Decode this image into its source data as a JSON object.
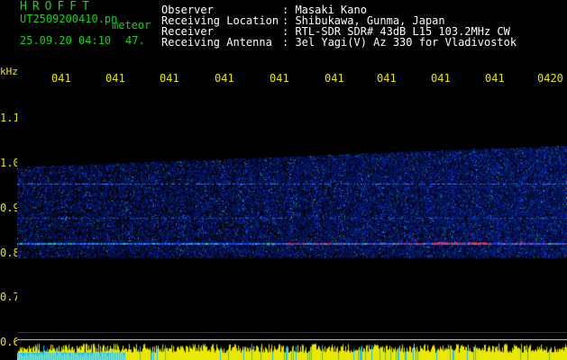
{
  "header": {
    "brand": "HROFFT",
    "filename": "UT2509200410.pn",
    "mode": "meteor",
    "timestamp": "25.09.20 04:10",
    "count": "47.",
    "fields": [
      {
        "label": "Observer",
        "value": ": Masaki Kano"
      },
      {
        "label": "Receiving Location",
        "value": ": Shibukawa, Gunma, Japan"
      },
      {
        "label": "Receiver",
        "value": ": RTL-SDR SDR# 43dB L15 103.2MHz CW"
      },
      {
        "label": "Receiving Antenna",
        "value": ": 3el Yagi(V) Az 330 for Vladivostok"
      }
    ]
  },
  "axis": {
    "unit": "kHz",
    "time_ticks": [
      "041",
      "041",
      "041",
      "041",
      "041",
      "041",
      "041",
      "041",
      "041",
      "0420"
    ],
    "freq_ticks": [
      "1.1",
      "1.0",
      "0.9",
      "0.8",
      "0.7",
      "0.6"
    ]
  },
  "colors": {
    "header_green": "#19d219",
    "tick_yellow": "#e8e800",
    "label_white": "#ffffff",
    "background": "#000000"
  }
}
